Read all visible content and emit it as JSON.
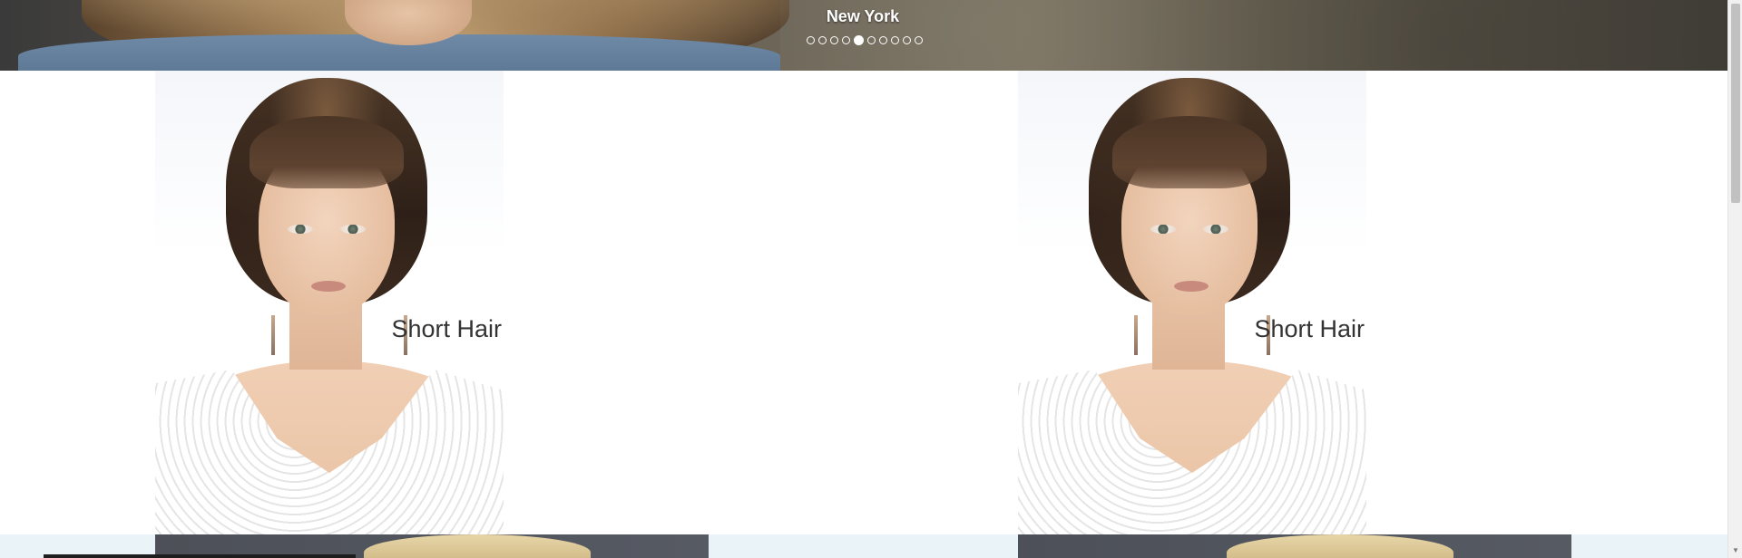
{
  "hero": {
    "caption": "New York",
    "dots": {
      "count": 10,
      "active_index": 4
    }
  },
  "cards": [
    {
      "label": "Short Hair"
    },
    {
      "label": "Short Hair"
    }
  ],
  "icons": {
    "carousel_dot": "circle-outline",
    "scroll_down": "triangle-down"
  },
  "colors": {
    "label_text": "#333333",
    "hero_caption": "#ffffff",
    "bottom_strip": "#e9f3f8"
  }
}
